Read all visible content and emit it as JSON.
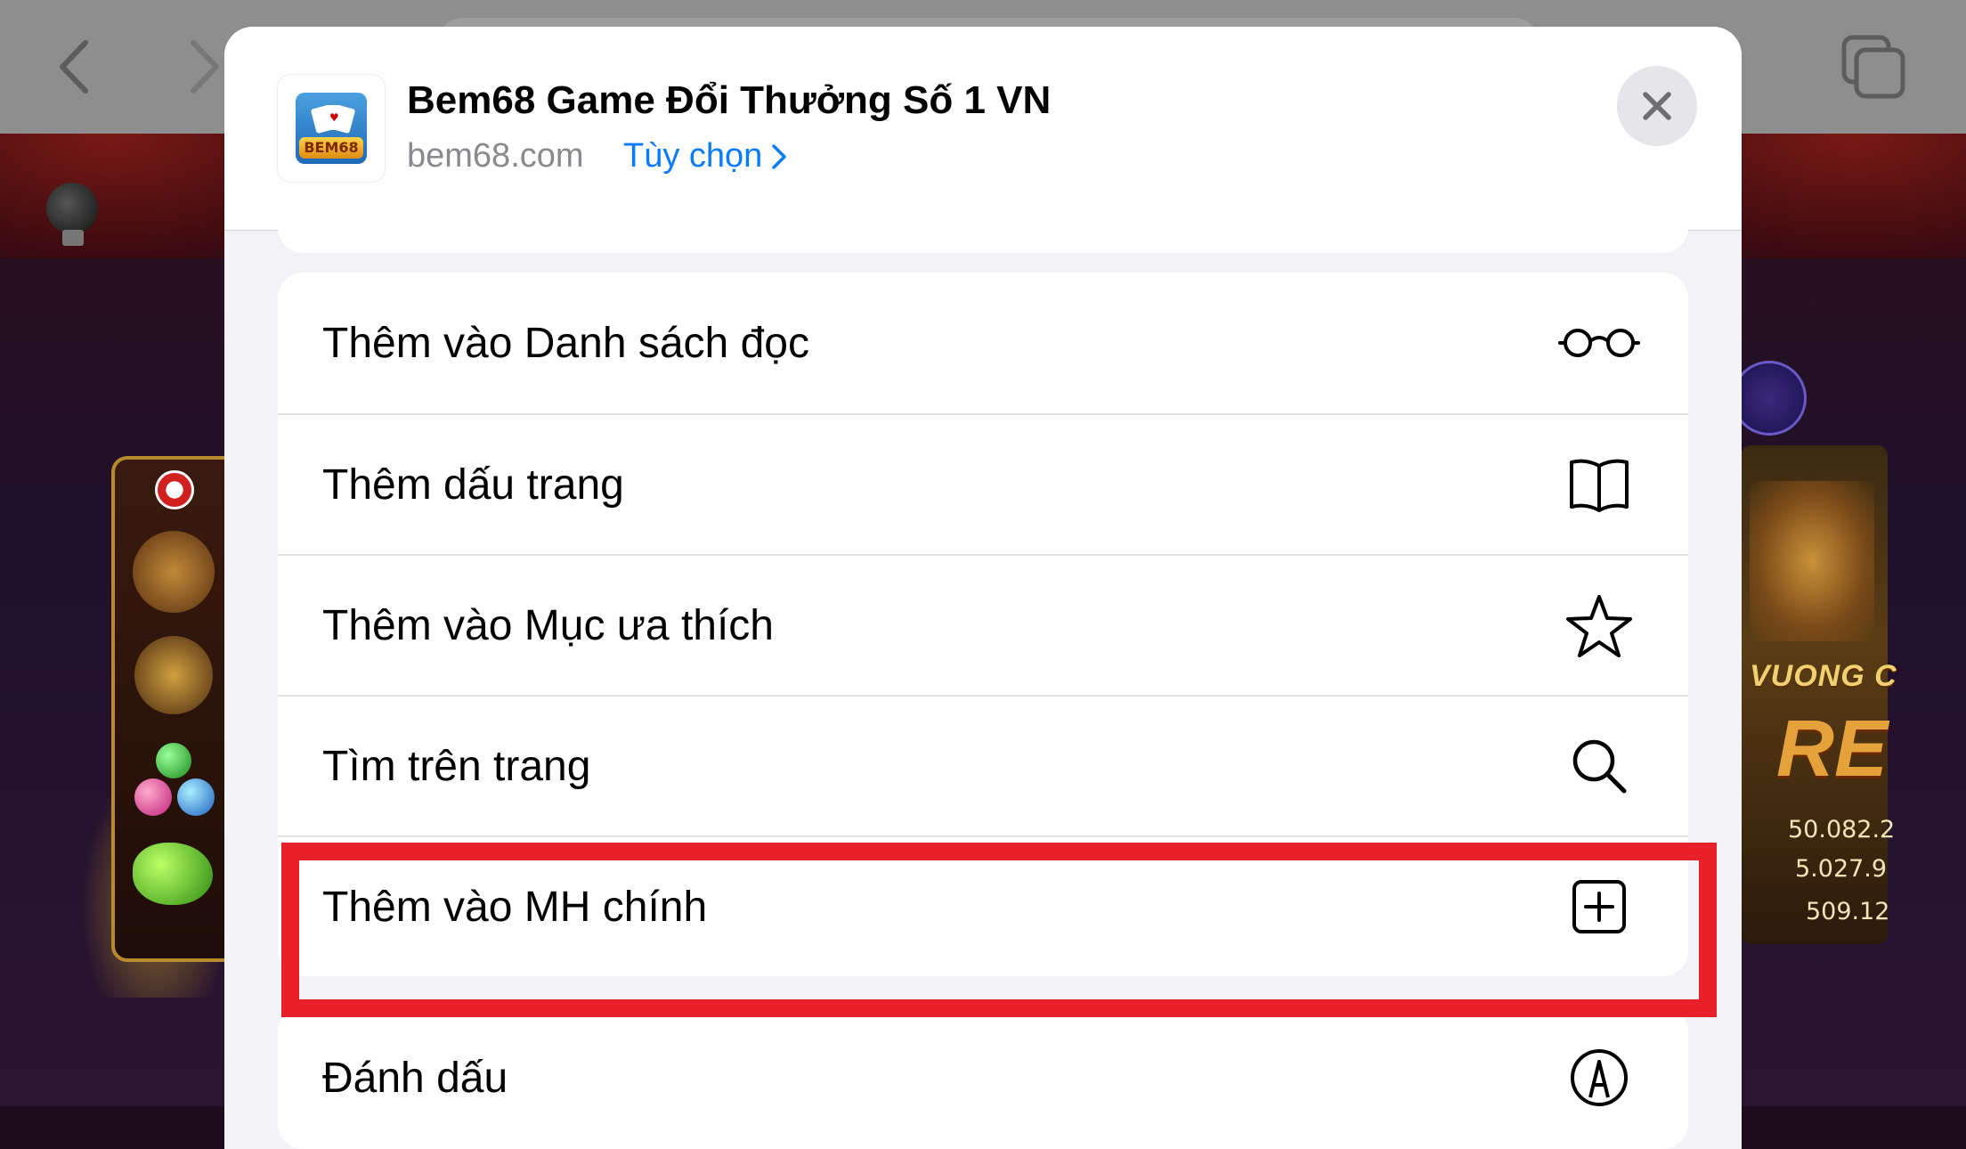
{
  "share_sheet": {
    "site_title": "Bem68 Game Đổi Thưởng Số 1 VN",
    "site_domain": "bem68.com",
    "options_label": "Tùy chọn",
    "app_icon_text": "BEM68"
  },
  "menu": {
    "group1": [
      {
        "label": "Thêm vào Danh sách đọc",
        "icon": "glasses-icon"
      },
      {
        "label": "Thêm dấu trang",
        "icon": "book-icon"
      },
      {
        "label": "Thêm vào Mục ưa thích",
        "icon": "star-icon"
      },
      {
        "label": "Tìm trên trang",
        "icon": "search-icon"
      },
      {
        "label": "Thêm vào MH chính",
        "icon": "add-square-icon"
      }
    ],
    "group2": [
      {
        "label": "Đánh dấu",
        "icon": "markup-icon"
      }
    ]
  },
  "background_game": {
    "banner_text": "VUONG C",
    "big_text": "RE",
    "jackpots": [
      "50.082.2",
      "5.027.9",
      "509.12"
    ]
  },
  "colors": {
    "accent": "#0a7aff",
    "highlight": "#e8202a",
    "sheet_bg": "#f2f2f7"
  }
}
